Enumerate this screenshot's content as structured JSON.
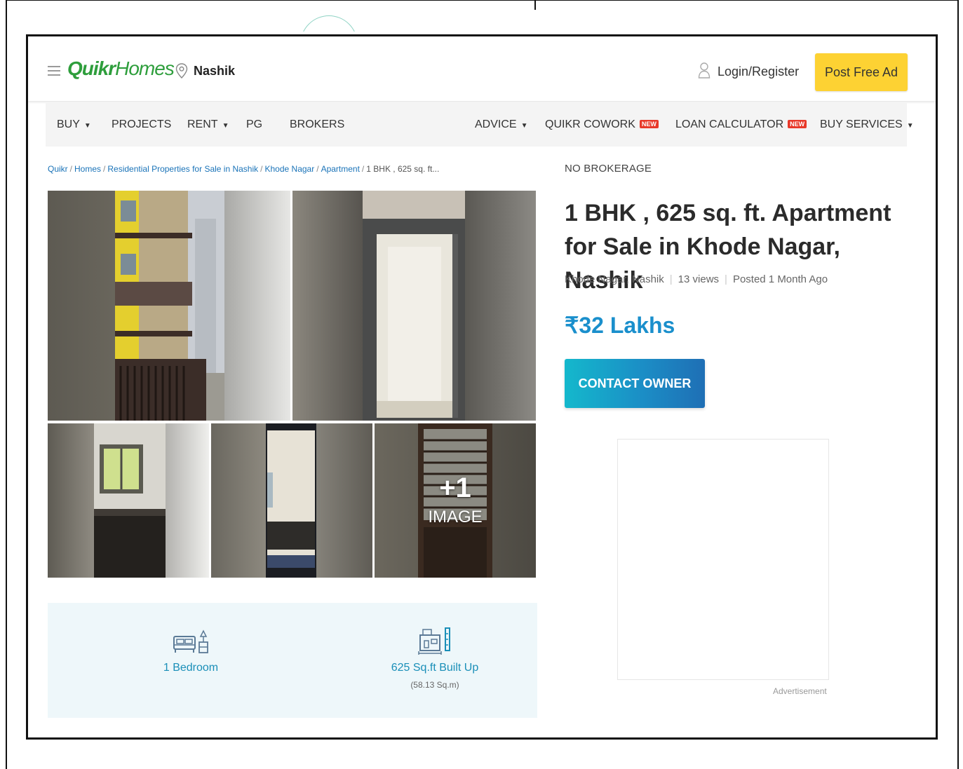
{
  "header": {
    "logo_primary": "Quikr",
    "logo_secondary": "Homes",
    "city": "Nashik",
    "login_label": "Login/Register",
    "post_ad_label": "Post Free Ad"
  },
  "nav": {
    "items": [
      {
        "label": "BUY",
        "dropdown": true
      },
      {
        "label": "PROJECTS"
      },
      {
        "label": "RENT",
        "dropdown": true
      },
      {
        "label": "PG"
      },
      {
        "label": "BROKERS"
      },
      {
        "label": "ADVICE",
        "dropdown": true
      },
      {
        "label": "QUIKR COWORK",
        "badge": "NEW"
      },
      {
        "label": "LOAN CALCULATOR",
        "badge": "NEW"
      },
      {
        "label": "BUY SERVICES",
        "dropdown": true
      }
    ]
  },
  "breadcrumb": {
    "items": [
      "Quikr",
      "Homes",
      "Residential Properties for Sale in Nashik",
      "Khode Nagar",
      "Apartment"
    ],
    "current": "1 BHK , 625 sq. ft..."
  },
  "gallery": {
    "more_count": "+1",
    "more_label": "IMAGE"
  },
  "specs": {
    "bedroom": "1 Bedroom",
    "area": "625 Sq.ft Built Up",
    "area_sub": "(58.13 Sq.m)"
  },
  "listing": {
    "tag": "NO BROKERAGE",
    "title": "1 BHK , 625 sq. ft. Apartment for Sale in Khode Nagar, Nashik",
    "location": "Khode Nagar, Nashik",
    "views": "13 views",
    "posted": "Posted 1 Month Ago",
    "price": "₹32 Lakhs",
    "contact_label": "CONTACT OWNER"
  },
  "ad": {
    "label": "Advertisement"
  },
  "colors": {
    "brand_green": "#2e9e3c",
    "post_ad_yellow": "#fdd233",
    "price_blue": "#1a8fcc",
    "new_badge_red": "#e8392a"
  }
}
